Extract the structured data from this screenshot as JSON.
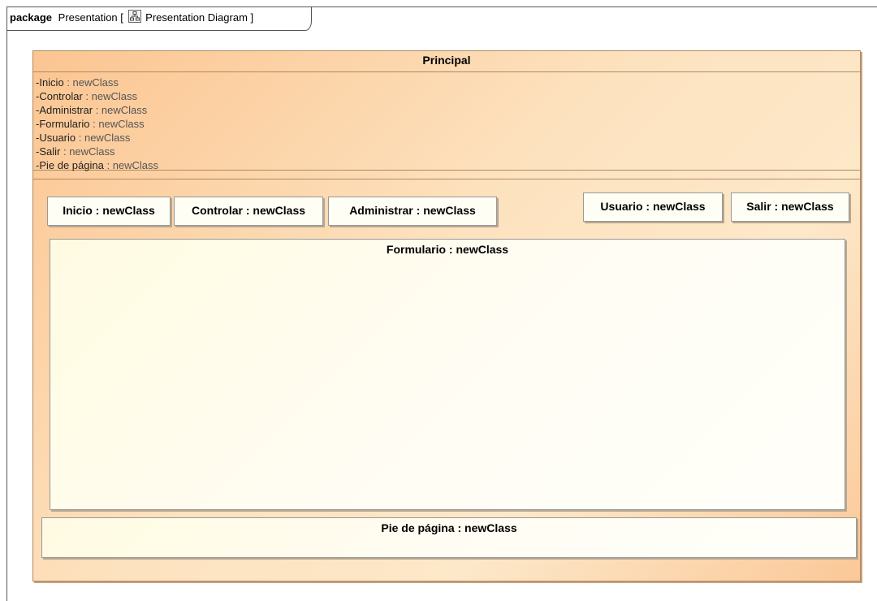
{
  "frame": {
    "keyword": "package",
    "name": "Presentation",
    "open_bracket": "[",
    "diagram_name": "Presentation Diagram",
    "close_bracket": "]"
  },
  "principal": {
    "title": "Principal",
    "attributes": [
      {
        "name": "-Inicio",
        "sep": " : ",
        "type": "newClass"
      },
      {
        "name": "-Controlar",
        "sep": " : ",
        "type": "newClass"
      },
      {
        "name": "-Administrar",
        "sep": " : ",
        "type": "newClass"
      },
      {
        "name": "-Formulario",
        "sep": " : ",
        "type": "newClass"
      },
      {
        "name": "-Usuario",
        "sep": " : ",
        "type": "newClass"
      },
      {
        "name": "-Salir",
        "sep": " : ",
        "type": "newClass"
      },
      {
        "name": "-Pie de página",
        "sep": " : ",
        "type": "newClass"
      }
    ],
    "parts": {
      "inicio": "Inicio : newClass",
      "controlar": "Controlar : newClass",
      "administrar": "Administrar : newClass",
      "usuario": "Usuario : newClass",
      "salir": "Salir : newClass",
      "formulario": "Formulario : newClass",
      "pie": "Pie de página : newClass"
    }
  },
  "colors": {
    "class_fill_start": "#fbc591",
    "class_fill_mid": "#fde2bf",
    "part_fill": "#fffef4",
    "border": "#b08a62"
  },
  "icons": {
    "diagram": "class-diagram-icon"
  }
}
